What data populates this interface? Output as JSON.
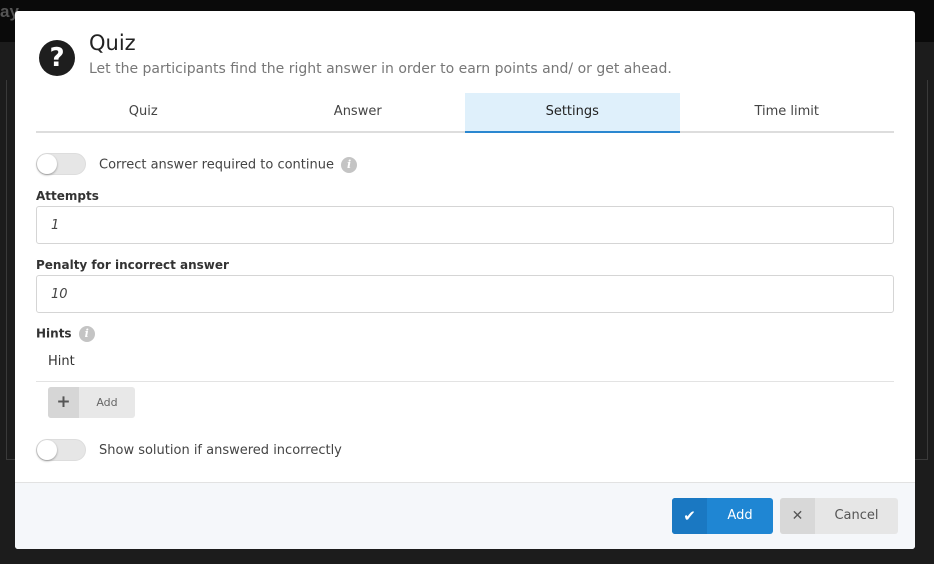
{
  "backdrop": {
    "edge_text": "ay"
  },
  "dialog": {
    "title": "Quiz",
    "subtitle": "Let the participants find the right answer in order to earn points and/ or get ahead.",
    "icon": "question-circle-icon"
  },
  "tabs": [
    {
      "label": "Quiz",
      "active": false
    },
    {
      "label": "Answer",
      "active": false
    },
    {
      "label": "Settings",
      "active": true
    },
    {
      "label": "Time limit",
      "active": false
    }
  ],
  "settings": {
    "correct_required": {
      "label": "Correct answer required to continue",
      "enabled": false
    },
    "attempts": {
      "label": "Attempts",
      "value": "1"
    },
    "penalty": {
      "label": "Penalty for incorrect answer",
      "value": "10"
    },
    "hints": {
      "label": "Hints",
      "column_header": "Hint",
      "add_label": "Add"
    },
    "show_solution": {
      "label": "Show solution if answered incorrectly",
      "enabled": false
    }
  },
  "footer": {
    "add_label": "Add",
    "cancel_label": "Cancel"
  },
  "colors": {
    "accent": "#1f86d3",
    "active_tab_bg": "#dff0fb"
  }
}
